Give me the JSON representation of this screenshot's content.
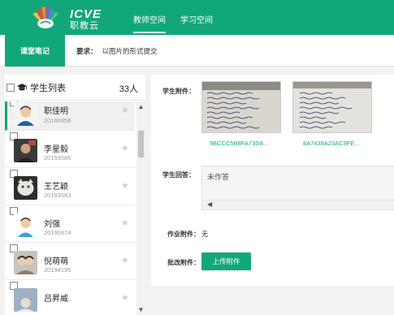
{
  "header": {
    "brand_top": "ICVE",
    "brand_bottom": "职教云",
    "nav": [
      {
        "label": "教师空间",
        "active": true
      },
      {
        "label": "学习空间",
        "active": false
      }
    ],
    "accent_color": "#12a77a"
  },
  "subheader": {
    "tab_label": "课堂笔记",
    "requirement_label": "要求：",
    "requirement_text": "以图片的形式提交"
  },
  "student_list": {
    "title": "学生列表",
    "count": "33人",
    "items": [
      {
        "name": "职佳明",
        "id": "20190858",
        "selected": true
      },
      {
        "name": "李星毅",
        "id": "20193585",
        "selected": false
      },
      {
        "name": "王艺颖",
        "id": "20193583",
        "selected": false
      },
      {
        "name": "刘强",
        "id": "20190874",
        "selected": false
      },
      {
        "name": "倪萌萌",
        "id": "20194195",
        "selected": false
      },
      {
        "name": "吕昇威",
        "id": "",
        "selected": false
      }
    ]
  },
  "detail": {
    "attachments_label": "学生附件：",
    "attachments": [
      {
        "name": "9BCCC5B8FA73D8..."
      },
      {
        "name": "8A7439A23AC9FE..."
      }
    ],
    "answer_label": "学生回答：",
    "answer_text": "未作答",
    "homework_attach_label": "作业附件：",
    "homework_attach_value": "无",
    "grading_attach_label": "批改附件：",
    "upload_button": "上传附件"
  }
}
